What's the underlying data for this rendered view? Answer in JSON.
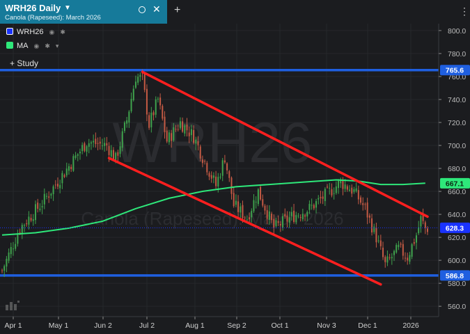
{
  "tab": {
    "symbol": "WRH26 Daily",
    "description": "Canola (Rapeseed): March 2026"
  },
  "legend": [
    {
      "name": "WRH26",
      "color": "#1a33ff"
    },
    {
      "name": "MA",
      "color": "#2ee87a"
    }
  ],
  "study_button": "Study",
  "colors": {
    "background": "#1b1c1f",
    "up": "#3fa34d",
    "down": "#c45a44",
    "ma": "#2ee87a",
    "trendline": "#ff1f1f",
    "hline": "#1f5fe0"
  },
  "icons": [
    "caret-down-icon",
    "circle-icon",
    "close-icon",
    "plus-icon",
    "kebab-menu-icon",
    "eye-icon",
    "gear-icon",
    "chevron-down-icon",
    "plus-icon",
    "logo-icon"
  ],
  "chart_data": {
    "type": "candlestick",
    "watermark": {
      "symbol": "WRH26",
      "name": "Canola (Rapeseed): March 2026"
    },
    "y_ticks": [
      560,
      580,
      600,
      620,
      640,
      660,
      680,
      700,
      720,
      740,
      760,
      780,
      800
    ],
    "ylim": [
      551,
      806
    ],
    "x_ticks": [
      "Apr 1",
      "May 1",
      "Jun 2",
      "Jul 2",
      "Aug 1",
      "Sep 2",
      "Oct 1",
      "Nov 3",
      "Dec 1",
      "2026"
    ],
    "price_badges": [
      {
        "label": "765.6",
        "value": 765.6,
        "color": "#1f5fe0"
      },
      {
        "label": "667.1",
        "value": 667.1,
        "color": "#2ee87a"
      },
      {
        "label": "628.3",
        "value": 628.3,
        "color": "#1a33ff"
      },
      {
        "label": "586.8",
        "value": 586.8,
        "color": "#1f5fe0"
      }
    ],
    "horizontal_lines": [
      765.6,
      586.8
    ],
    "last_price": 628.3,
    "close_anchors": [
      {
        "i": 0,
        "v": 591
      },
      {
        "i": 8,
        "v": 628
      },
      {
        "i": 18,
        "v": 650
      },
      {
        "i": 30,
        "v": 682
      },
      {
        "i": 38,
        "v": 703
      },
      {
        "i": 47,
        "v": 700
      },
      {
        "i": 51,
        "v": 688
      },
      {
        "i": 56,
        "v": 722
      },
      {
        "i": 60,
        "v": 760
      },
      {
        "i": 63,
        "v": 758
      },
      {
        "i": 66,
        "v": 718
      },
      {
        "i": 70,
        "v": 740
      },
      {
        "i": 74,
        "v": 704
      },
      {
        "i": 80,
        "v": 720
      },
      {
        "i": 86,
        "v": 708
      },
      {
        "i": 90,
        "v": 690
      },
      {
        "i": 96,
        "v": 665
      },
      {
        "i": 100,
        "v": 690
      },
      {
        "i": 104,
        "v": 648
      },
      {
        "i": 110,
        "v": 637
      },
      {
        "i": 115,
        "v": 660
      },
      {
        "i": 122,
        "v": 628
      },
      {
        "i": 130,
        "v": 638
      },
      {
        "i": 138,
        "v": 645
      },
      {
        "i": 146,
        "v": 658
      },
      {
        "i": 152,
        "v": 668
      },
      {
        "i": 158,
        "v": 660
      },
      {
        "i": 163,
        "v": 645
      },
      {
        "i": 168,
        "v": 620
      },
      {
        "i": 172,
        "v": 596
      },
      {
        "i": 178,
        "v": 610
      },
      {
        "i": 182,
        "v": 603
      },
      {
        "i": 186,
        "v": 622
      },
      {
        "i": 188,
        "v": 636
      },
      {
        "i": 190,
        "v": 628
      }
    ],
    "ma_points": [
      {
        "i": 0,
        "v": 622
      },
      {
        "i": 15,
        "v": 624
      },
      {
        "i": 30,
        "v": 628
      },
      {
        "i": 45,
        "v": 634
      },
      {
        "i": 60,
        "v": 645
      },
      {
        "i": 75,
        "v": 654
      },
      {
        "i": 90,
        "v": 660
      },
      {
        "i": 105,
        "v": 664
      },
      {
        "i": 120,
        "v": 666
      },
      {
        "i": 135,
        "v": 668
      },
      {
        "i": 150,
        "v": 670
      },
      {
        "i": 160,
        "v": 669
      },
      {
        "i": 170,
        "v": 666
      },
      {
        "i": 180,
        "v": 666
      },
      {
        "i": 190,
        "v": 667.1
      }
    ],
    "trendlines": [
      {
        "from": {
          "i": 63,
          "v": 764
        },
        "to": {
          "i": 191,
          "v": 638
        }
      },
      {
        "from": {
          "i": 48,
          "v": 689
        },
        "to": {
          "i": 170,
          "v": 579
        }
      }
    ]
  }
}
